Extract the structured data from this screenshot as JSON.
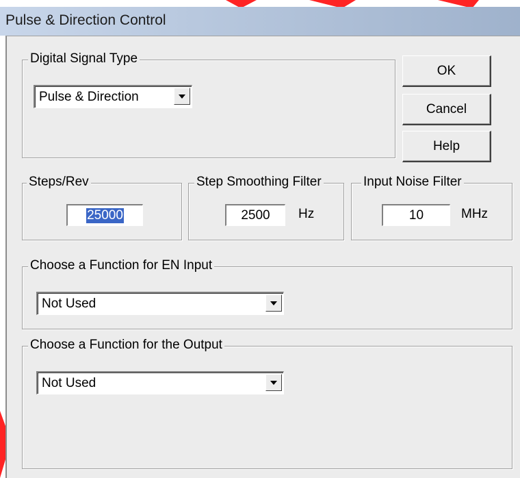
{
  "window": {
    "title": "Pulse & Direction Control"
  },
  "signal_group": {
    "legend": "Digital Signal Type",
    "selected": "Pulse & Direction",
    "arrow_icon": "chevron-down-icon"
  },
  "buttons": {
    "ok": "OK",
    "cancel": "Cancel",
    "help": "Help"
  },
  "steps_group": {
    "legend": "Steps/Rev",
    "value": "25000"
  },
  "smoothing_group": {
    "legend": "Step Smoothing Filter",
    "value": "2500",
    "unit": "Hz"
  },
  "noise_group": {
    "legend": "Input Noise Filter",
    "value": "10",
    "unit": "MHz"
  },
  "en_group": {
    "legend": "Choose a Function for EN Input",
    "selected": "Not Used"
  },
  "output_group": {
    "legend": "Choose a Function for the Output",
    "selected": "Not Used"
  },
  "colors": {
    "selection": "#3a66c6",
    "decoration": "#ff2020",
    "dialog_bg": "#ececec"
  }
}
